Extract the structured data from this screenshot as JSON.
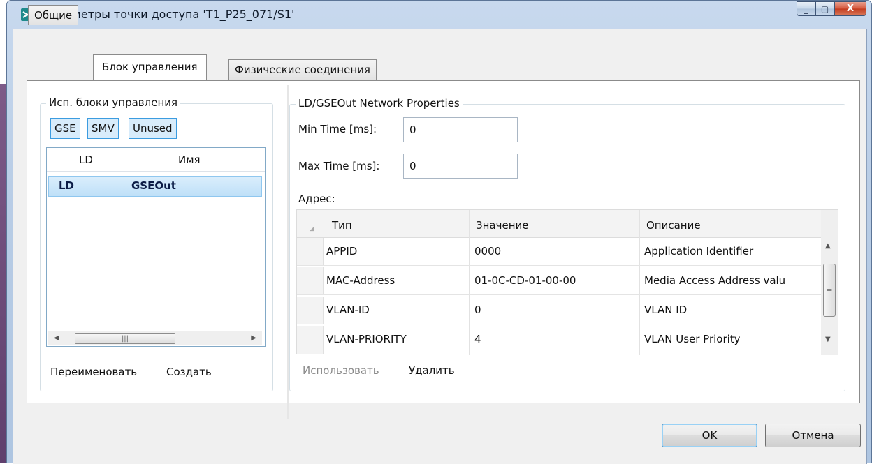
{
  "window": {
    "title": "Параметры точки доступа 'T1_P25_071/S1'",
    "controls": {
      "minimize": "_",
      "maximize": "▢",
      "close": "X"
    }
  },
  "tabs": [
    {
      "label": "Общие",
      "active": false
    },
    {
      "label": "Блок управления",
      "active": true
    },
    {
      "label": "Физические соединения",
      "active": false
    }
  ],
  "left_panel": {
    "group_title": "Исп. блоки управления",
    "filters": [
      "GSE",
      "SMV",
      "Unused"
    ],
    "list": {
      "columns": [
        "LD",
        "Имя"
      ],
      "rows": [
        {
          "ld": "LD",
          "name": "GSEOut",
          "selected": true
        }
      ],
      "scroll_grip": "|||"
    },
    "actions": {
      "rename": "Переименовать",
      "create": "Создать"
    }
  },
  "right_panel": {
    "group_title": "LD/GSEOut Network Properties",
    "min_time": {
      "label": "Min Time [ms]:",
      "value": "0"
    },
    "max_time": {
      "label": "Max Time [ms]:",
      "value": "0"
    },
    "address_label": "Адрес:",
    "grid": {
      "columns": [
        "Тип",
        "Значение",
        "Описание"
      ],
      "rows": [
        {
          "type": "APPID",
          "value": "0000",
          "description": "Application Identifier"
        },
        {
          "type": "MAC-Address",
          "value": "01-0C-CD-01-00-00",
          "description": "Media Access Address valu"
        },
        {
          "type": "VLAN-ID",
          "value": "0",
          "description": "VLAN ID"
        },
        {
          "type": "VLAN-PRIORITY",
          "value": "4",
          "description": "VLAN User Priority"
        }
      ],
      "scroll_grip": "≡"
    },
    "actions": {
      "use": "Использовать",
      "delete": "Удалить"
    }
  },
  "footer": {
    "ok": "OK",
    "cancel": "Отмена"
  },
  "colors": {
    "accent": "#3c9ce0",
    "selection": "#bfe0f8",
    "disabled_text": "#8a8a8a"
  }
}
